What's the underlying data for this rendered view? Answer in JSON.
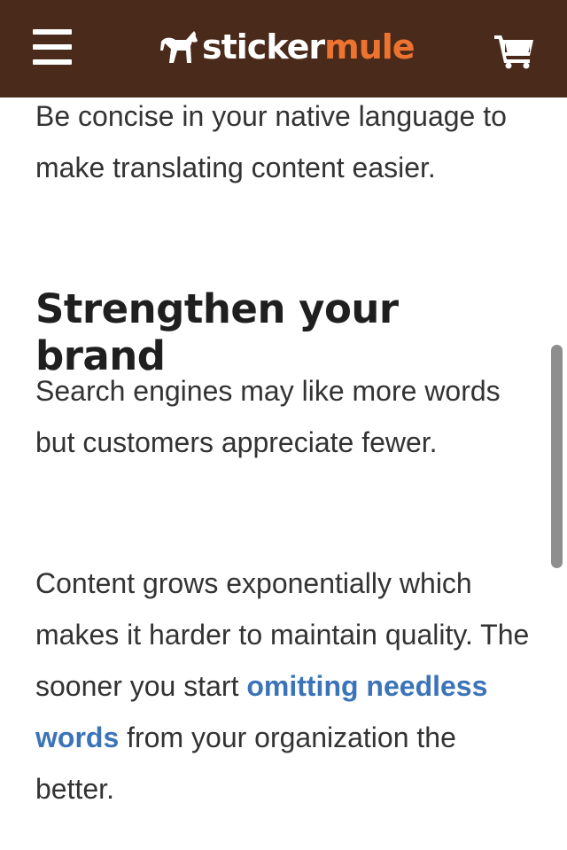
{
  "header": {
    "logo": {
      "part1": "sticker",
      "part2": "mule",
      "part2_color": "#ed7430",
      "icon": "mule-icon"
    },
    "menu_icon": "hamburger-menu-icon",
    "cart_icon": "cart-icon",
    "background_color": "#4a2a1a"
  },
  "article": {
    "intro_paragraph": "Be concise in your native language to make translating content easier.",
    "heading": "Strengthen your brand",
    "paragraph_2": "Search engines may like more words but customers appreciate fewer.",
    "paragraph_3": {
      "before_link": "Content grows exponentially which makes it harder to maintain quality. The sooner you start ",
      "link_text": "omitting needless words",
      "after_link": " from your organization the better."
    },
    "link_color": "#3b74b8"
  }
}
